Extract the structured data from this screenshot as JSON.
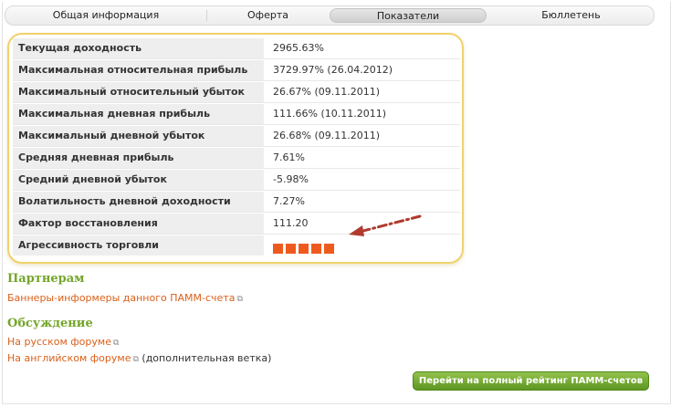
{
  "tabs": [
    {
      "label": "Общая информация"
    },
    {
      "label": "Оферта"
    },
    {
      "label": "Показатели",
      "active": true
    },
    {
      "label": "Бюллетень"
    }
  ],
  "stats": [
    {
      "label": "Текущая доходность",
      "value": "2965.63%"
    },
    {
      "label": "Максимальная относительная прибыль",
      "value": "3729.97% (26.04.2012)"
    },
    {
      "label": "Максимальный относительный убыток",
      "value": "26.67% (09.11.2011)"
    },
    {
      "label": "Максимальная дневная прибыль",
      "value": "111.66% (10.11.2011)"
    },
    {
      "label": "Максимальный дневной убыток",
      "value": "26.68% (09.11.2011)"
    },
    {
      "label": "Средняя дневная прибыль",
      "value": "7.61%"
    },
    {
      "label": "Средний дневной убыток",
      "value": "-5.98%"
    },
    {
      "label": "Волатильность дневной доходности",
      "value": "7.27%"
    },
    {
      "label": "Фактор восстановления",
      "value": "111.20"
    },
    {
      "label": "Агрессивность торговли",
      "level": 5,
      "level_max": 5
    }
  ],
  "partners": {
    "title": "Партнерам",
    "link": "Баннеры-информеры данного ПАММ-счета"
  },
  "discussion": {
    "title": "Обсуждение",
    "link_ru": "На русском форуме",
    "link_en": "На английском форуме",
    "note_en": "(дополнительная ветка)"
  },
  "rating_button": "Перейти на полный рейтинг ПАММ-счетов",
  "colors": {
    "accent_green": "#74a52a",
    "link_orange": "#d9601a",
    "aggr_square": "#ee5a1e",
    "highlight_border": "#f1d26b",
    "arrow": "#b03a2e"
  }
}
